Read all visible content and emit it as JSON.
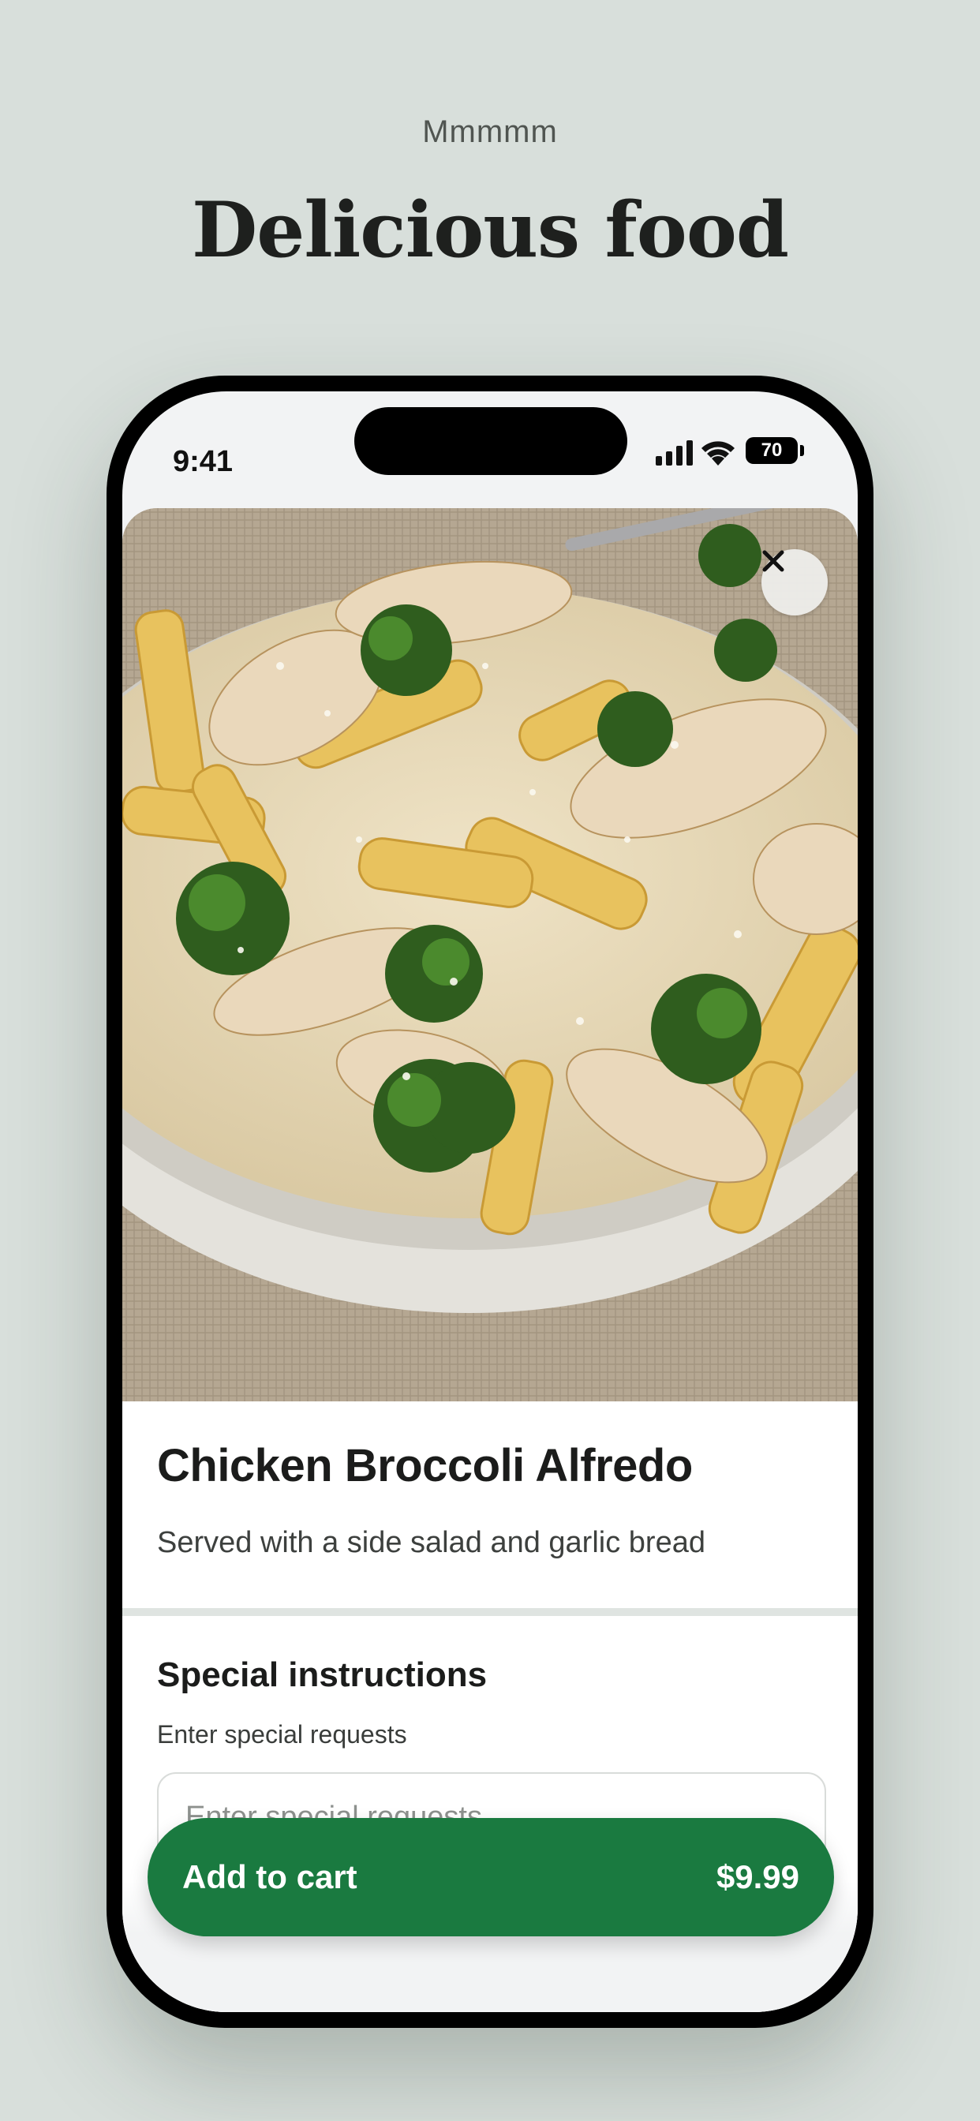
{
  "page": {
    "eyebrow": "Mmmmm",
    "title": "Delicious food"
  },
  "status_bar": {
    "time": "9:41",
    "battery": "70",
    "icons": [
      "cellular-signal-icon",
      "wifi-icon",
      "battery-icon"
    ]
  },
  "item": {
    "image_alt": "Plate of penne pasta with grilled chicken, broccoli and parmesan",
    "close_icon": "close-icon",
    "name": "Chicken Broccoli Alfredo",
    "description": "Served with a side salad and garlic bread"
  },
  "special_instructions": {
    "title": "Special instructions",
    "label": "Enter special requests",
    "placeholder": "Enter special requests",
    "value": ""
  },
  "cart_button": {
    "label": "Add to cart",
    "price": "$9.99"
  },
  "colors": {
    "background": "#d8dfdb",
    "accent": "#1a7a40",
    "text": "#1b1c1b"
  }
}
